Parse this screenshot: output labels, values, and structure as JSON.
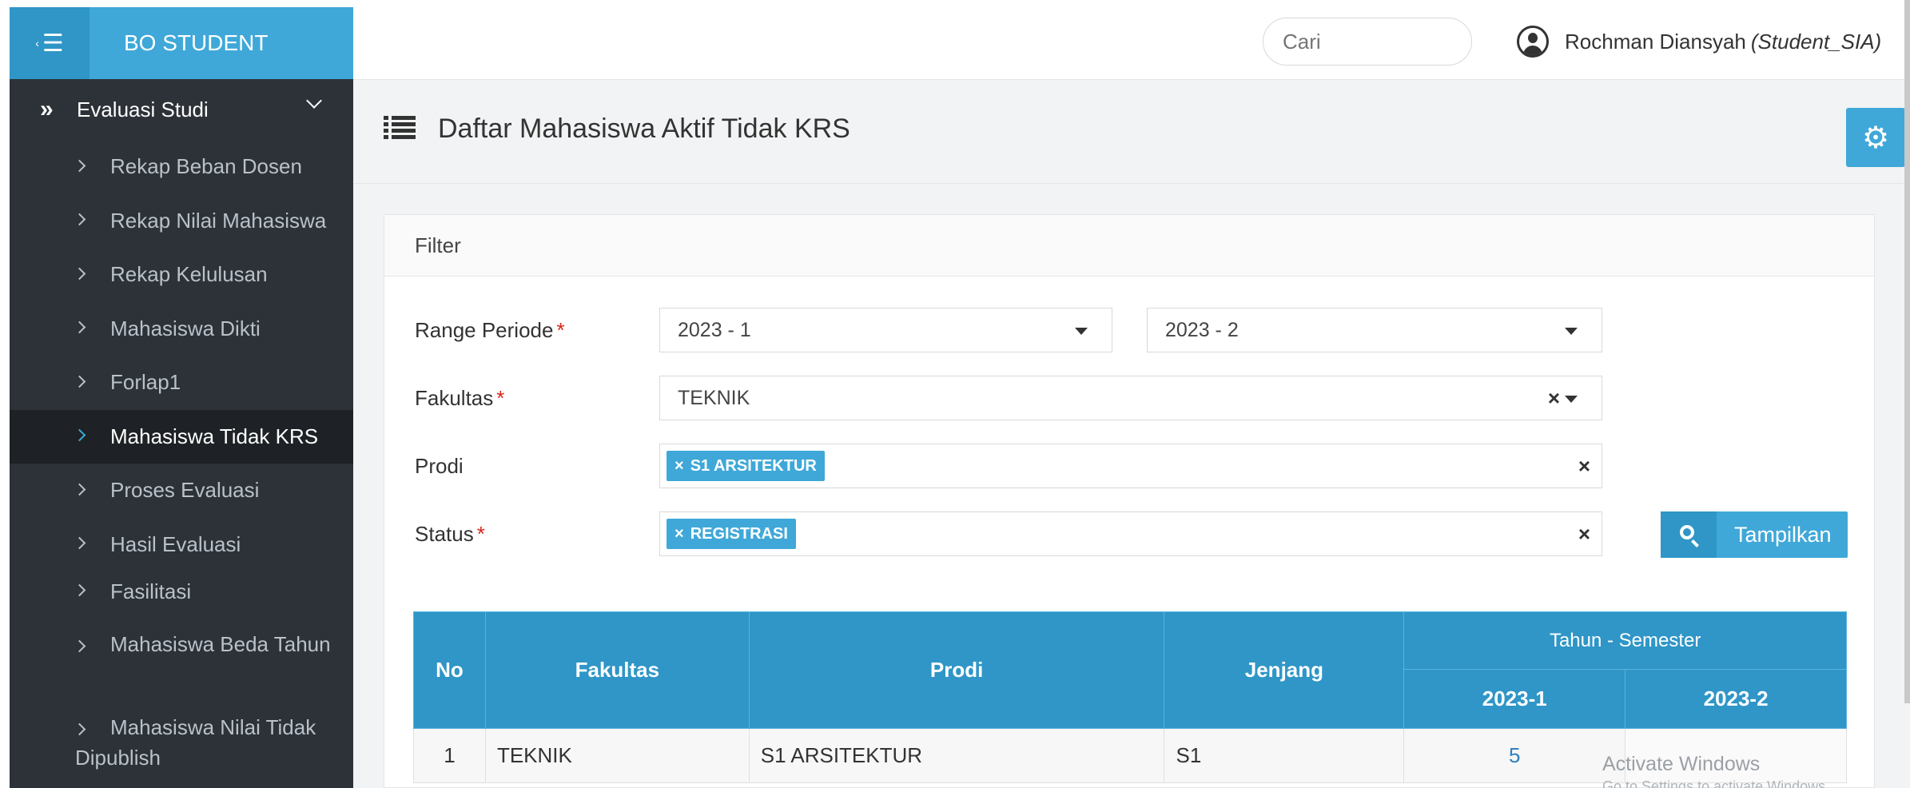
{
  "brand": {
    "title": "BO STUDENT",
    "toggle_icon": "menu-collapse-icon"
  },
  "sidebar": {
    "parent": {
      "label": "Evaluasi Studi",
      "icon": "double-chevron-right-icon"
    },
    "items": [
      {
        "label": "Rekap Beban Dosen"
      },
      {
        "label": "Rekap Nilai Mahasiswa"
      },
      {
        "label": "Rekap Kelulusan"
      },
      {
        "label": "Mahasiswa Dikti"
      },
      {
        "label": "Forlap1"
      },
      {
        "label": "Mahasiswa Tidak KRS",
        "active": true
      },
      {
        "label": "Proses Evaluasi"
      },
      {
        "label": "Hasil Evaluasi"
      },
      {
        "label": "Fasilitasi"
      },
      {
        "label": "Mahasiswa Beda Tahun"
      },
      {
        "label": "Mahasiswa Nilai Tidak Dipublish"
      }
    ]
  },
  "topbar": {
    "search_placeholder": "Cari",
    "user_name": "Rochman Diansyah",
    "user_role": "(Student_SIA)"
  },
  "page": {
    "title": "Daftar Mahasiswa Aktif Tidak KRS"
  },
  "filter": {
    "heading": "Filter",
    "range_label": "Range Periode",
    "range_from": "2023 - 1",
    "range_to": "2023 - 2",
    "fakultas_label": "Fakultas",
    "fakultas_value": "TEKNIK",
    "prodi_label": "Prodi",
    "prodi_tag": "S1 ARSITEKTUR",
    "status_label": "Status",
    "status_tag": "REGISTRASI",
    "required_mark": "*",
    "tag_remove": "×",
    "clear": "×",
    "show_button": "Tampilkan"
  },
  "table": {
    "headers": {
      "no": "No",
      "fakultas": "Fakultas",
      "prodi": "Prodi",
      "jenjang": "Jenjang",
      "tahun_semester": "Tahun - Semester",
      "sem1": "2023-1",
      "sem2": "2023-2"
    },
    "rows": [
      {
        "no": "1",
        "fakultas": "TEKNIK",
        "prodi": "S1 ARSITEKTUR",
        "jenjang": "S1",
        "sem1": "5",
        "sem2": ""
      }
    ]
  },
  "watermark": {
    "line1": "Activate Windows",
    "line2": "Go to Settings to activate Windows."
  },
  "colors": {
    "accent": "#3fa8d8",
    "header_blue": "#2f96c7",
    "sidebar_bg": "#2d3238",
    "required": "#d9241b"
  }
}
